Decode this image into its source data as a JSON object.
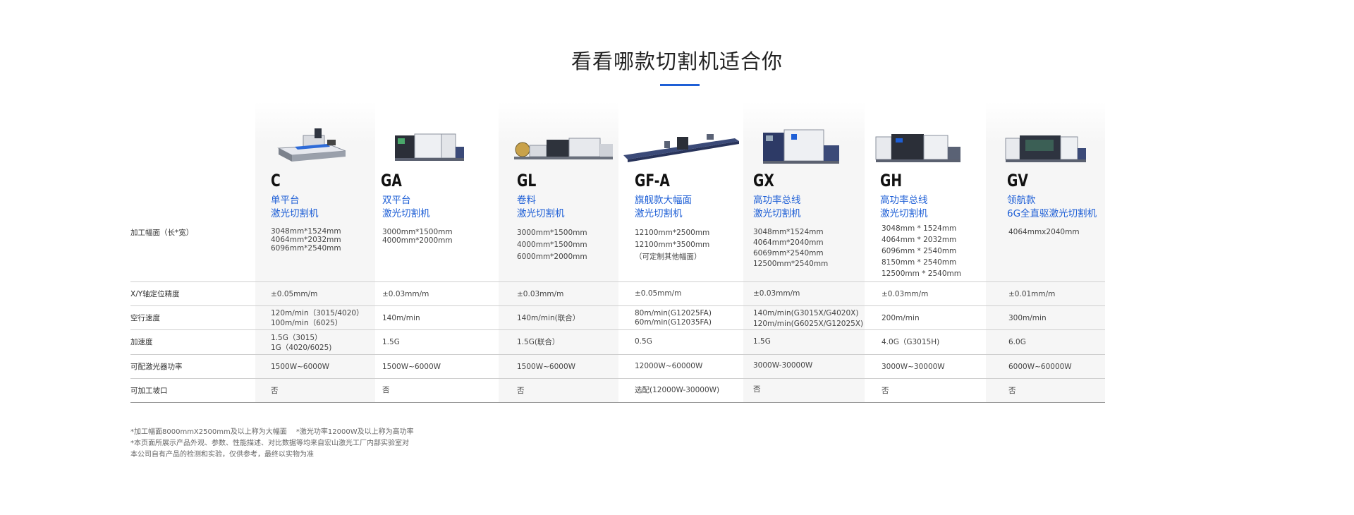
{
  "page_title": "看看哪款切割机适合你",
  "row_labels": {
    "size": "加工幅面（长*宽）",
    "accuracy": "X/Y轴定位精度",
    "idle_speed": "空行速度",
    "acceleration": "加速度",
    "laser_power": "可配激光器功率",
    "bevel": "可加工坡口"
  },
  "models": [
    {
      "name": "C",
      "subtitle_1": "单平台",
      "subtitle_2": "激光切割机",
      "size": "3048mm*1524mm\n4064mm*2032mm\n6096mm*2540mm",
      "accuracy": "±0.05mm/m",
      "idle_speed": "120m/min（3015/4020）\n100m/min（6025）",
      "acceleration": "1.5G（3015）\n1G（4020/6025)",
      "laser_power": "1500W~6000W",
      "bevel": "否"
    },
    {
      "name": "GA",
      "subtitle_1": "双平台",
      "subtitle_2": "激光切割机",
      "size": "3000mm*1500mm\n4000mm*2000mm",
      "accuracy": "±0.03mm/m",
      "idle_speed": "140m/min",
      "acceleration": "1.5G",
      "laser_power": "1500W~6000W",
      "bevel": "否"
    },
    {
      "name": "GL",
      "subtitle_1": "卷料",
      "subtitle_2": "激光切割机",
      "size": "3000mm*1500mm\n4000mm*1500mm\n6000mm*2000mm",
      "accuracy": "±0.03mm/m",
      "idle_speed": "140m/min(联合）",
      "acceleration": "1.5G(联合）",
      "laser_power": "1500W~6000W",
      "bevel": "否"
    },
    {
      "name": "GF-A",
      "subtitle_1": "旗舰款大幅面",
      "subtitle_2": "激光切割机",
      "size": "12100mm*2500mm\n12100mm*3500mm\n（可定制其他幅面）",
      "accuracy": "±0.05mm/m",
      "idle_speed": "80m/min(G12025FA)\n60m/min(G12035FA)",
      "acceleration": "0.5G",
      "laser_power": "12000W~60000W",
      "bevel": "选配(12000W-30000W)"
    },
    {
      "name": "GX",
      "subtitle_1": "高功率总线",
      "subtitle_2": "激光切割机",
      "size": "3048mm*1524mm\n4064mm*2040mm\n6069mm*2540mm\n12500mm*2540mm",
      "accuracy": "±0.03mm/m",
      "idle_speed": "140m/min(G3015X/G4020X)\n120m/min(G6025X/G12025X)",
      "acceleration": "1.5G",
      "laser_power": "3000W-30000W",
      "bevel": "否"
    },
    {
      "name": "GH",
      "subtitle_1": "高功率总线",
      "subtitle_2": "激光切割机",
      "size": "3048mm * 1524mm\n4064mm * 2032mm\n6096mm * 2540mm\n8150mm * 2540mm\n12500mm * 2540mm",
      "accuracy": "±0.03mm/m",
      "idle_speed": "200m/min",
      "acceleration": "4.0G（G3015H)",
      "laser_power": "3000W~30000W",
      "bevel": "否"
    },
    {
      "name": "GV",
      "subtitle_1": "领航款",
      "subtitle_2": "6G全直驱激光切割机",
      "size": "4064mmx2040mm",
      "accuracy": "±0.01mm/m",
      "idle_speed": "300m/min",
      "acceleration": "6.0G",
      "laser_power": "6000W~60000W",
      "bevel": "否"
    }
  ],
  "notes": {
    "line1": "*加工幅面8000mmX2500mm及以上称为大幅面　 *激光功率12000W及以上称为高功率",
    "line2": "*本页面所展示产品外观、参数、性能描述、对比数据等均来自宏山激光工厂内部实验室对",
    "line3": " 本公司自有产品的检测和实验，仅供参考，最终以实物为准"
  },
  "colors": {
    "accent": "#1e5fd6",
    "column_shade": "#f6f6f6",
    "divider": "#cfcfcf"
  }
}
